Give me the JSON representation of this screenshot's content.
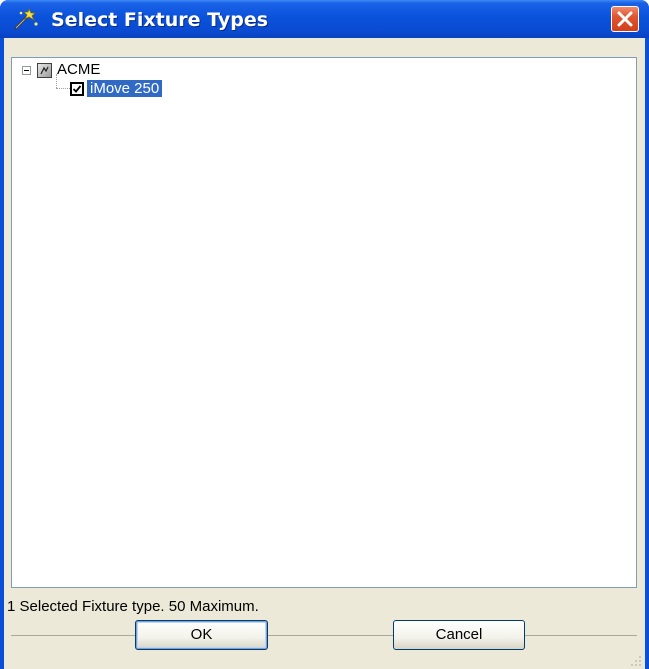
{
  "window": {
    "title": "Select Fixture Types",
    "app_icon": "magic-wand-icon",
    "close_icon": "close-icon"
  },
  "tree": {
    "root": {
      "label": "ACME",
      "icon": "manufacturer-icon",
      "expanded": true,
      "children": [
        {
          "label": "iMove 250",
          "checked": true,
          "selected": true
        }
      ]
    }
  },
  "status": {
    "text": "1 Selected Fixture type. 50 Maximum."
  },
  "buttons": {
    "ok_label": "OK",
    "cancel_label": "Cancel"
  },
  "colors": {
    "titlebar": "#0a52db",
    "close_button": "#e0552f",
    "selection": "#316ac5",
    "dialog_face": "#ece9d8"
  }
}
